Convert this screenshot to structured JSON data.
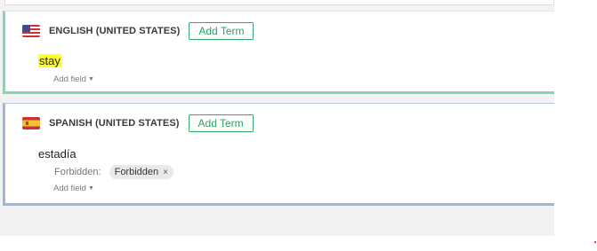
{
  "colors": {
    "english_accent": "#86d6ac",
    "spanish_accent": "#9fb6dc",
    "button_green": "#2aa163",
    "term_highlight": "#ffff20"
  },
  "english": {
    "flag_icon": "us-flag-icon",
    "language": "ENGLISH (UNITED STATES)",
    "add_term_label": "Add Term",
    "term": "stay",
    "add_field_label": "Add field"
  },
  "spanish": {
    "flag_icon": "spain-flag-icon",
    "language": "SPANISH (UNITED STATES)",
    "add_term_label": "Add Term",
    "term": "estadía",
    "forbidden_label": "Forbidden:",
    "forbidden_tag": "Forbidden",
    "tag_remove_icon": "close-icon",
    "add_field_label": "Add field"
  }
}
